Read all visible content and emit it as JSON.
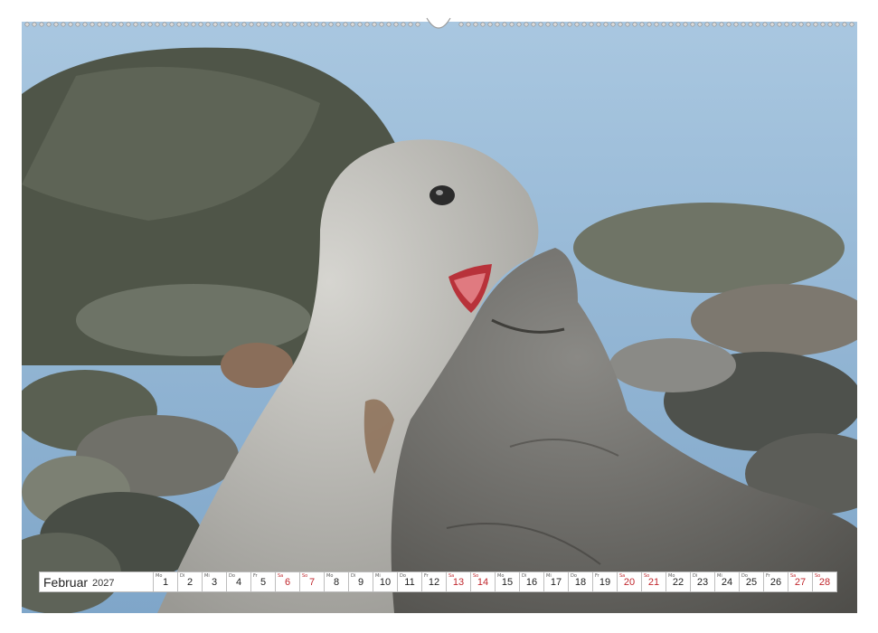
{
  "calendar": {
    "month": "Februar",
    "year": "2027",
    "days": [
      {
        "num": "1",
        "wd": "Mo",
        "weekend": false
      },
      {
        "num": "2",
        "wd": "Di",
        "weekend": false
      },
      {
        "num": "3",
        "wd": "Mi",
        "weekend": false
      },
      {
        "num": "4",
        "wd": "Do",
        "weekend": false
      },
      {
        "num": "5",
        "wd": "Fr",
        "weekend": false
      },
      {
        "num": "6",
        "wd": "Sa",
        "weekend": true
      },
      {
        "num": "7",
        "wd": "So",
        "weekend": true
      },
      {
        "num": "8",
        "wd": "Mo",
        "weekend": false
      },
      {
        "num": "9",
        "wd": "Di",
        "weekend": false
      },
      {
        "num": "10",
        "wd": "Mi",
        "weekend": false
      },
      {
        "num": "11",
        "wd": "Do",
        "weekend": false
      },
      {
        "num": "12",
        "wd": "Fr",
        "weekend": false
      },
      {
        "num": "13",
        "wd": "Sa",
        "weekend": true
      },
      {
        "num": "14",
        "wd": "So",
        "weekend": true
      },
      {
        "num": "15",
        "wd": "Mo",
        "weekend": false
      },
      {
        "num": "16",
        "wd": "Di",
        "weekend": false
      },
      {
        "num": "17",
        "wd": "Mi",
        "weekend": false
      },
      {
        "num": "18",
        "wd": "Do",
        "weekend": false
      },
      {
        "num": "19",
        "wd": "Fr",
        "weekend": false
      },
      {
        "num": "20",
        "wd": "Sa",
        "weekend": true
      },
      {
        "num": "21",
        "wd": "So",
        "weekend": true
      },
      {
        "num": "22",
        "wd": "Mo",
        "weekend": false
      },
      {
        "num": "23",
        "wd": "Di",
        "weekend": false
      },
      {
        "num": "24",
        "wd": "Mi",
        "weekend": false
      },
      {
        "num": "25",
        "wd": "Do",
        "weekend": false
      },
      {
        "num": "26",
        "wd": "Fr",
        "weekend": false
      },
      {
        "num": "27",
        "wd": "Sa",
        "weekend": true
      },
      {
        "num": "28",
        "wd": "So",
        "weekend": true
      }
    ]
  },
  "colors": {
    "weekend": "#c0272d",
    "sea": "#9fc0dc",
    "seal_light": "#c9c9c5",
    "seal_dark": "#6b6a66",
    "rocks": "#5e655a"
  }
}
